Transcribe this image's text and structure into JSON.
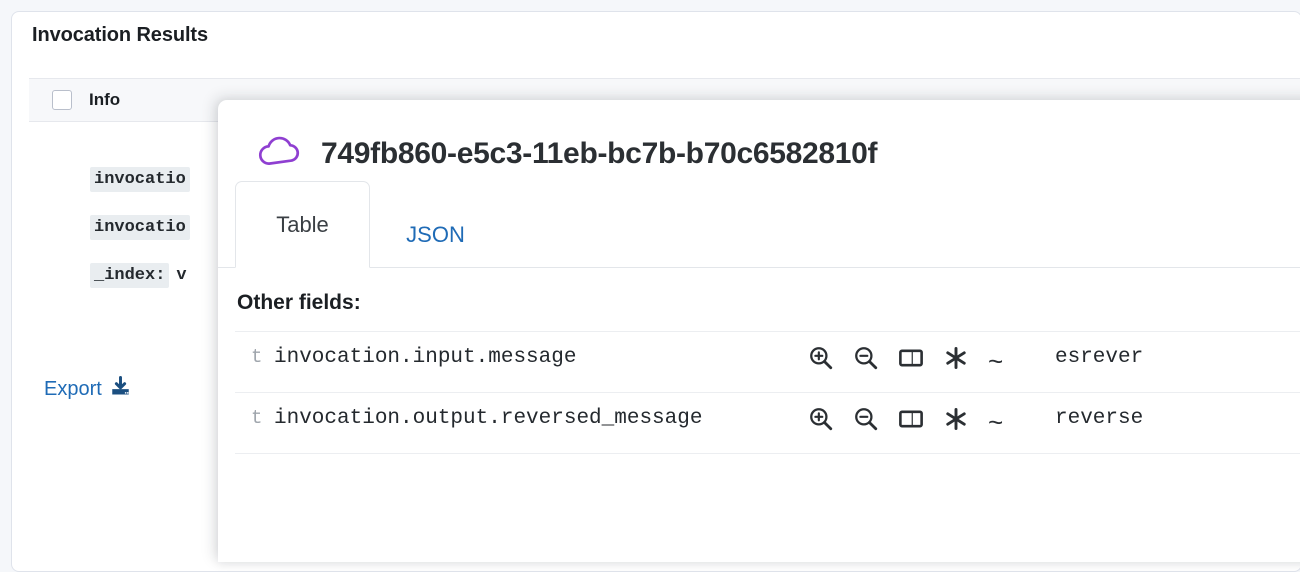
{
  "page": {
    "results_card_title": "Invocation Results"
  },
  "info_section": {
    "label": "Info",
    "checkbox_checked": false,
    "fields": [
      {
        "key": "invocatio",
        "value": ""
      },
      {
        "key": "invocatio",
        "value": ""
      },
      {
        "key": "_index:",
        "value": "v"
      }
    ],
    "export_label": "Export",
    "export_icon": "download-icon"
  },
  "popup": {
    "icon": "cloud-icon",
    "icon_color": "#8f3fd1",
    "title": "749fb860-e5c3-11eb-bc7b-b70c6582810f",
    "tabs": [
      {
        "label": "Table",
        "active": true
      },
      {
        "label": "JSON",
        "active": false
      }
    ],
    "section_heading": "Other fields:",
    "row_actions": [
      {
        "name": "filter-for-value-icon",
        "glyph": "zoom-in"
      },
      {
        "name": "filter-out-value-icon",
        "glyph": "zoom-out"
      },
      {
        "name": "toggle-column-icon",
        "glyph": "columns"
      },
      {
        "name": "filter-field-present-icon",
        "glyph": "asterisk"
      },
      {
        "name": "tilde-icon",
        "glyph": "~"
      }
    ],
    "rows": [
      {
        "type": "t",
        "field": "invocation.input.message",
        "value": "esrever"
      },
      {
        "type": "t",
        "field": "invocation.output.reversed_message",
        "value": "reverse"
      }
    ]
  },
  "colors": {
    "link": "#1f6bb6",
    "accent_purple": "#8f3fd1",
    "text": "#24292e",
    "page_bg": "#f5f7fa"
  }
}
